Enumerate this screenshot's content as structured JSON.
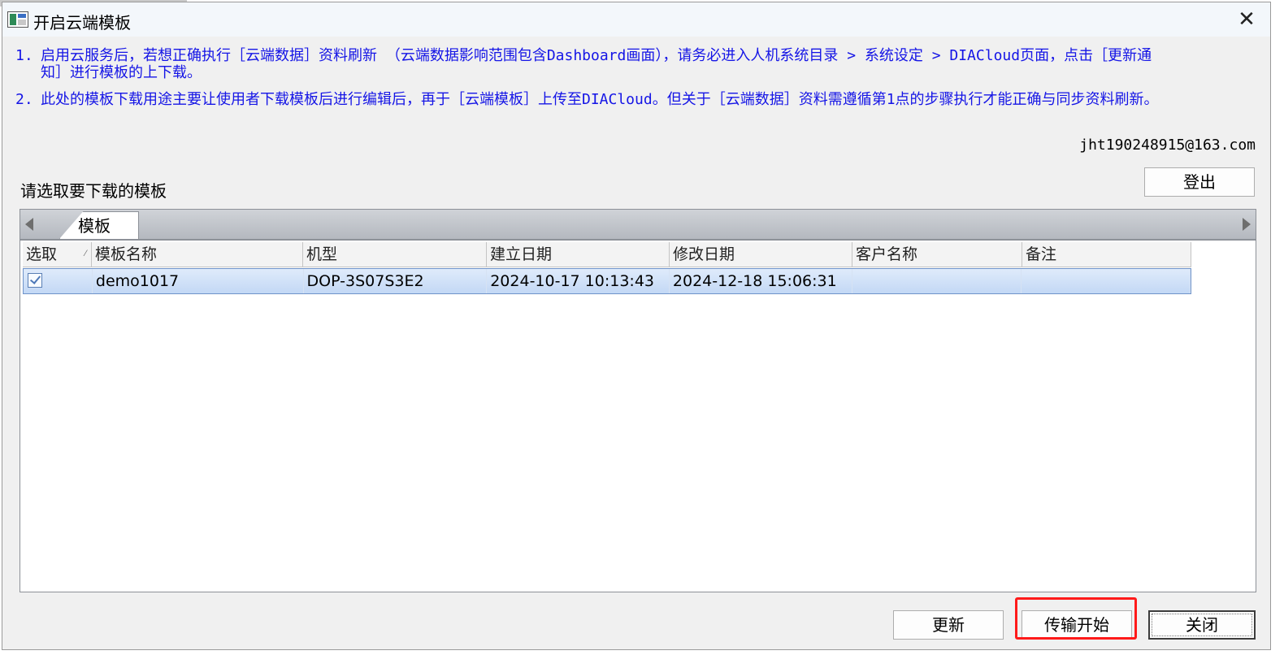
{
  "window": {
    "title": "开启云端模板"
  },
  "notes": [
    {
      "num": "1.",
      "text": "启用云服务后，若想正确执行［云端数据］资料刷新 （云端数据影响范围包含Dashboard画面），请务必进入人机系统目录 > 系统设定 > DIACloud页面，点击［更新通知］进行模板的上下载。"
    },
    {
      "num": "2.",
      "text": "此处的模板下载用途主要让使用者下载模板后进行编辑后，再于［云端模板］上传至DIACloud。但关于［云端数据］资料需遵循第1点的步骤执行才能正确与同步资料刷新。"
    }
  ],
  "account": {
    "email": "jht190248915@163.com",
    "logout_label": "登出"
  },
  "select_label": "请选取要下载的模板",
  "tabs": [
    {
      "label": "模板"
    }
  ],
  "table": {
    "columns": [
      "选取",
      "模板名称",
      "机型",
      "建立日期",
      "修改日期",
      "客户名称",
      "备注"
    ],
    "rows": [
      {
        "selected": true,
        "name": "demo1017",
        "model": "DOP-3S07S3E2",
        "created": "2024-10-17 10:13:43",
        "modified": "2024-12-18 15:06:31",
        "customer": "",
        "remark": ""
      }
    ]
  },
  "buttons": {
    "update": "更新",
    "start": "传输开始",
    "close": "关闭"
  }
}
